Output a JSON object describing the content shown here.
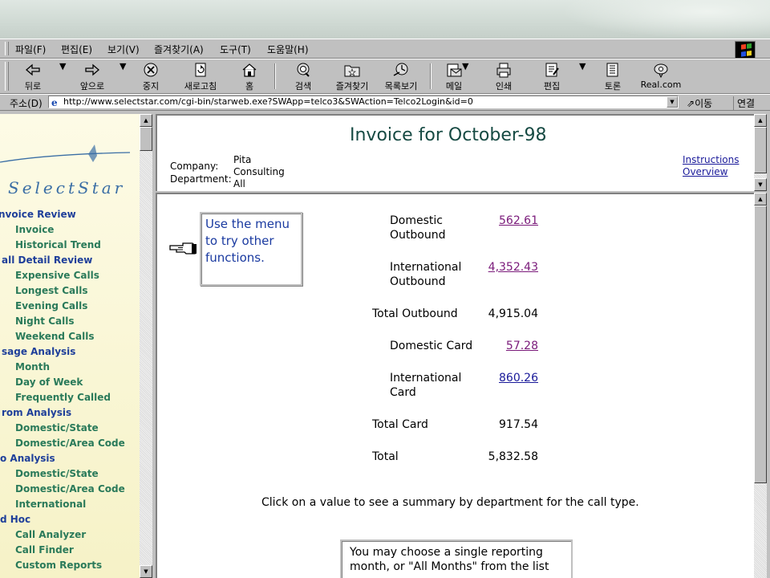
{
  "menu": {
    "items": [
      "파일(F)",
      "편집(E)",
      "보기(V)",
      "즐겨찾기(A)",
      "도구(T)",
      "도움말(H)"
    ]
  },
  "toolbar": {
    "back": "뒤로",
    "forward": "앞으로",
    "stop": "중지",
    "refresh": "새로고침",
    "home": "홈",
    "search": "검색",
    "favorites": "즐겨찾기",
    "history": "목록보기",
    "mail": "메일",
    "print": "인쇄",
    "edit": "편집",
    "discuss": "토론",
    "realcom": "Real.com"
  },
  "address": {
    "label": "주소(D)",
    "url": "http://www.selectstar.com/cgi-bin/starweb.exe?SWApp=telco3&SWAction=Telco2Login&id=0",
    "go": "이동",
    "links": "연결"
  },
  "sidebar": {
    "logo": "SelectStar",
    "items": [
      {
        "label": "nvoice Review",
        "type": "header"
      },
      {
        "label": "Invoice",
        "type": "item"
      },
      {
        "label": "Historical Trend",
        "type": "item"
      },
      {
        "label": "all Detail Review",
        "type": "header"
      },
      {
        "label": "Expensive Calls",
        "type": "item"
      },
      {
        "label": "Longest Calls",
        "type": "item"
      },
      {
        "label": "Evening Calls",
        "type": "item"
      },
      {
        "label": "Night Calls",
        "type": "item"
      },
      {
        "label": "Weekend Calls",
        "type": "item"
      },
      {
        "label": "sage Analysis",
        "type": "header"
      },
      {
        "label": "Month",
        "type": "item"
      },
      {
        "label": "Day of Week",
        "type": "item"
      },
      {
        "label": "Frequently Called",
        "type": "item"
      },
      {
        "label": "rom Analysis",
        "type": "header"
      },
      {
        "label": "Domestic/State",
        "type": "item"
      },
      {
        "label": "Domestic/Area Code",
        "type": "item"
      },
      {
        "label": "o Analysis",
        "type": "header"
      },
      {
        "label": "Domestic/State",
        "type": "item"
      },
      {
        "label": "Domestic/Area Code",
        "type": "item"
      },
      {
        "label": "International",
        "type": "item"
      },
      {
        "label": "d Hoc",
        "type": "header"
      },
      {
        "label": "Call Analyzer",
        "type": "item"
      },
      {
        "label": "Call Finder",
        "type": "item"
      },
      {
        "label": "Custom Reports",
        "type": "item"
      }
    ]
  },
  "header": {
    "title": "Invoice for October-98",
    "company_label": "Company:",
    "department_label": "Department:",
    "company_value_1": "Pita",
    "company_value_2": "Consulting",
    "department_value": "All",
    "instructions": "Instructions",
    "overview": "Overview"
  },
  "main": {
    "tip": "Use the menu to try other functions.",
    "rows": {
      "dom_out_1": "Domestic",
      "dom_out_2": "Outbound",
      "dom_out_val": "562.61",
      "intl_out_1": "International",
      "intl_out_2": "Outbound",
      "intl_out_val": "4,352.43",
      "total_out": "Total Outbound",
      "total_out_val": "4,915.04",
      "dom_card": "Domestic Card",
      "dom_card_val": "57.28",
      "intl_card_1": "International",
      "intl_card_2": "Card",
      "intl_card_val": "860.26",
      "total_card": "Total Card",
      "total_card_val": "917.54",
      "total": "Total",
      "total_val": "5,832.58"
    },
    "note": "Click on a value to see a summary by department for the call type.",
    "choose_1": "You may choose a single reporting",
    "choose_2": "month, or \"All Months\" from the list"
  },
  "colors": {
    "title": "#164a43",
    "visited_link": "#7a1a7a",
    "link": "#1a1a9a",
    "nav_header": "#1f3f9a",
    "nav_item": "#2a7a5a"
  }
}
